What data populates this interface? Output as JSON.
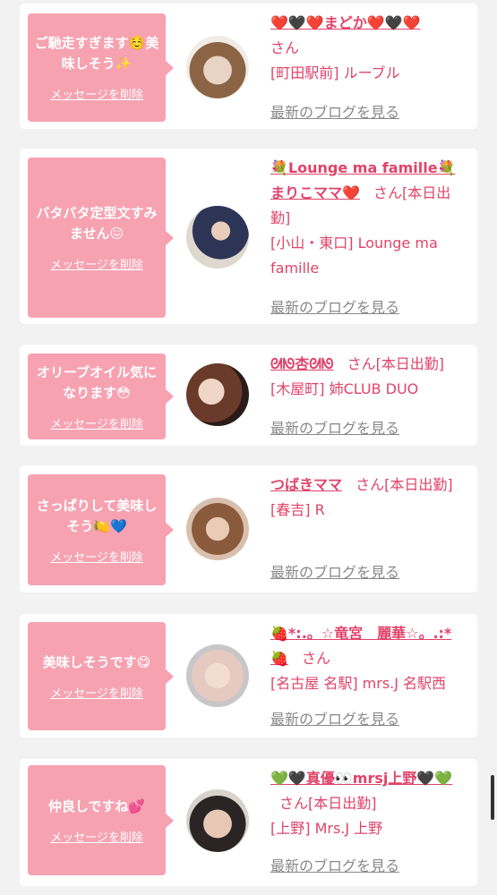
{
  "items": [
    {
      "message": "ご馳走すぎます☺️美味しそう✨",
      "delete_label": "メッセージを削除",
      "name": "❤️🖤❤️まどか❤️🖤❤️",
      "suffix": "さん",
      "location": "[町田駅前] ルーブル",
      "blog_link": "最新のブログを見る"
    },
    {
      "message": "バタバタ定型文すみません😖",
      "delete_label": "メッセージを削除",
      "name": "💐Lounge ma famille💐まりこママ❤️",
      "suffix": "さん[本日出勤]",
      "location": "[小山・東口] Lounge ma famille",
      "blog_link": "最新のブログを見る"
    },
    {
      "message": "オリーブオイル気になります😳",
      "delete_label": "メッセージを削除",
      "name": "ᘛᘚ杏ᘛᘚ",
      "suffix": "さん[本日出勤]",
      "location": "[木屋町] 姉CLUB DUO",
      "blog_link": "最新のブログを見る"
    },
    {
      "message": "さっぱりして美味しそう🍋💙",
      "delete_label": "メッセージを削除",
      "name": "つばきママ",
      "suffix": "さん[本日出勤]",
      "location": "[春吉] R",
      "blog_link": "最新のブログを見る"
    },
    {
      "message": "美味しそうです😋",
      "delete_label": "メッセージを削除",
      "name": "🍓*:.。☆竜宮　麗華☆。.:*🍓",
      "suffix": "さん",
      "location": "[名古屋 名駅] mrs.J 名駅西",
      "blog_link": "最新のブログを見る"
    },
    {
      "message": "仲良しですね💕",
      "delete_label": "メッセージを削除",
      "name": "💚🖤真優👀mrsj上野🖤💚",
      "suffix": "さん[本日出勤]",
      "location": "[上野] Mrs.J 上野",
      "blog_link": "最新のブログを見る"
    }
  ],
  "colors": {
    "bubble": "#f6a2b1",
    "name_pink": "#e0436a",
    "link_gray": "#888888",
    "background": "#f2f2f2"
  }
}
